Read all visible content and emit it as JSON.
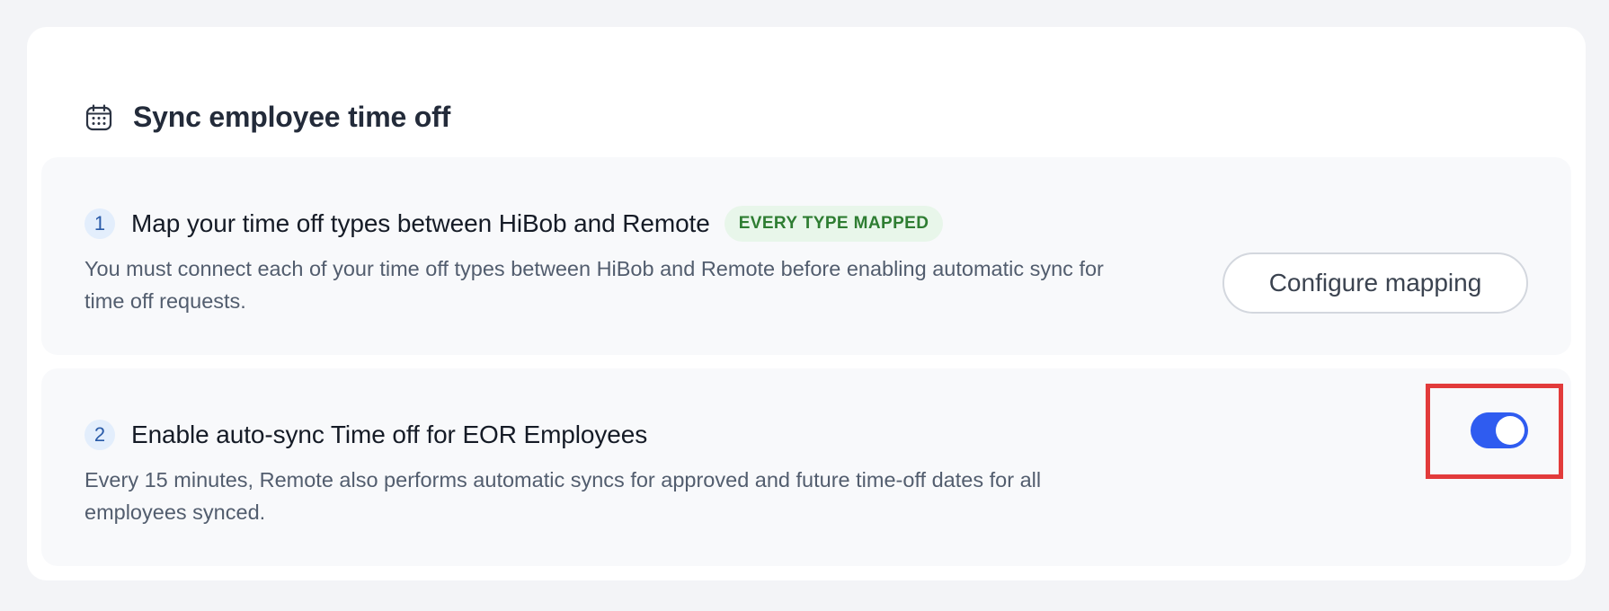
{
  "card": {
    "title": "Sync employee time off",
    "icon": "calendar-icon"
  },
  "steps": [
    {
      "number": "1",
      "title": "Map your time off types between HiBob and Remote",
      "badge": "EVERY TYPE MAPPED",
      "badge_color": "#2e7d32",
      "description": "You must connect each of your time off types between HiBob and Remote before enabling automatic sync for time off requests.",
      "action_label": "Configure mapping"
    },
    {
      "number": "2",
      "title": "Enable auto-sync Time off for EOR Employees",
      "description": "Every 15 minutes, Remote also performs automatic syncs for approved and future time-off dates for all employees synced.",
      "toggle_on": true
    }
  ],
  "colors": {
    "accent": "#2f5cf0",
    "highlight": "#e23b3b",
    "badge_bg": "#e8f6ea"
  }
}
